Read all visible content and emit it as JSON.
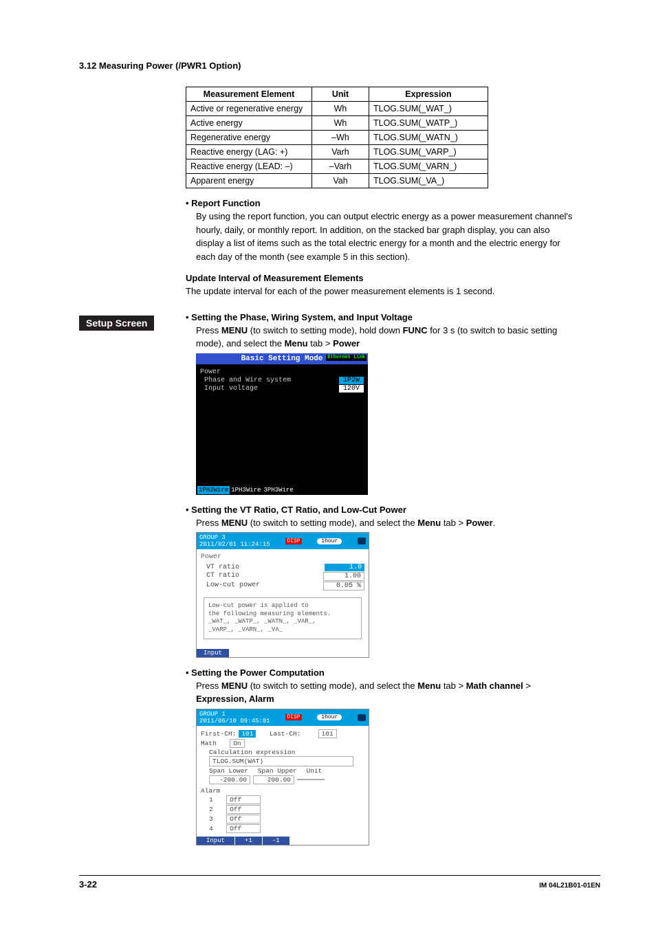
{
  "header": "3.12  Measuring Power (/PWR1 Option)",
  "table": {
    "headers": [
      "Measurement Element",
      "Unit",
      "Expression"
    ],
    "rows": [
      [
        "Active or regenerative energy",
        "Wh",
        "TLOG.SUM(_WAT_)"
      ],
      [
        "Active energy",
        "Wh",
        "TLOG.SUM(_WATP_)"
      ],
      [
        "Regenerative energy",
        "–Wh",
        "TLOG.SUM(_WATN_)"
      ],
      [
        "Reactive energy (LAG: +)",
        "Varh",
        "TLOG.SUM(_VARP_)"
      ],
      [
        "Reactive energy (LEAD: –)",
        "–Varh",
        "TLOG.SUM(_VARN_)"
      ],
      [
        "Apparent energy",
        "Vah",
        "TLOG.SUM(_VA_)"
      ]
    ]
  },
  "report": {
    "title": "Report Function",
    "body": "By using the report function, you can output electric energy as a power measurement channel's hourly, daily, or monthly report. In addition, on the stacked bar graph display, you can also display a list of items such as the total electric energy for a month and the electric energy for each day of the month (see example 5 in this section)."
  },
  "update": {
    "title": "Update Interval of Measurement Elements",
    "body": "The update interval for each of the power measurement elements is 1 second."
  },
  "sidebar": "Setup Screen",
  "sect1": {
    "title": "Setting the Phase, Wiring System, and Input Voltage",
    "pre": "Press ",
    "menu": "MENU",
    "mid1": " (to switch to setting mode), hold down ",
    "func": "FUNC",
    "mid2": " for 3 s (to switch to basic setting mode), and select the ",
    "menutab": "Menu",
    "mid3": " tab > ",
    "power": "Power"
  },
  "scr1": {
    "title": "Basic Setting Mode",
    "eth": "Ethernet\nLink",
    "section": "Power",
    "r1l": "Phase and Wire system",
    "r1v": "1P2W",
    "r2l": "Input voltage",
    "r2v": "120V",
    "tabs": [
      "1PH2Wire",
      "1PH3Wire",
      "3PH3Wire"
    ],
    "tabsel": 0
  },
  "sect2": {
    "title": "Setting the VT Ratio, CT Ratio, and Low-Cut Power",
    "pre": "Press ",
    "menu": "MENU",
    "mid": " (to switch to setting mode), and select the ",
    "menutab": "Menu",
    "mid2": " tab > ",
    "power": "Power",
    "end": "."
  },
  "scr2": {
    "topL": "GROUP 3",
    "topDate": "2011/02/01 11:24:15",
    "disp": "DISP",
    "pill": "1hour",
    "section": "Power",
    "r1l": "VT ratio",
    "r1v": "1.0",
    "r2l": "CT ratio",
    "r2v": "1.00",
    "r3l": "Low-cut power",
    "r3v": "0.05 %",
    "note": "Low-cut power is applied to\nthe following measuring elements.\n_WAT_, _WATP_, _WATN_, _VAR_,\n_VARP_, _VARN_, _VA_",
    "tab": "Input"
  },
  "sect3": {
    "title": "Setting the Power Computation",
    "pre": "Press ",
    "menu": "MENU",
    "mid": " (to switch to setting mode), and select the ",
    "menutab": "Menu",
    "mid2": " tab > ",
    "math": "Math channel",
    "mid3": " > ",
    "expr": "Expression, Alarm"
  },
  "scr3": {
    "topL": "GROUP 1",
    "topDate": "2011/06/10 09:45:01",
    "disp": "DISP",
    "pill": "1hour",
    "firstch_l": "First-CH:",
    "firstch_v": "101",
    "lastch_l": "Last-CH:",
    "lastch_v": "101",
    "math_l": "Math",
    "math_v": "On",
    "calc_l": "Calculation expression",
    "calc_v": "TLOG.SUM(WAT)",
    "span_l": "Span Lower",
    "span_u": "Span Upper",
    "unit_l": "Unit",
    "span_lv": "-200.00",
    "span_uv": "200.00",
    "unit_v": "",
    "alarm": "Alarm",
    "a1": "1",
    "a1v": "Off",
    "a2": "2",
    "a2v": "Off",
    "a3": "3",
    "a3v": "Off",
    "a4": "4",
    "a4v": "Off",
    "tabs": [
      "Input",
      "+1",
      "-1"
    ]
  },
  "footer": {
    "page": "3-22",
    "doc": "IM 04L21B01-01EN"
  }
}
